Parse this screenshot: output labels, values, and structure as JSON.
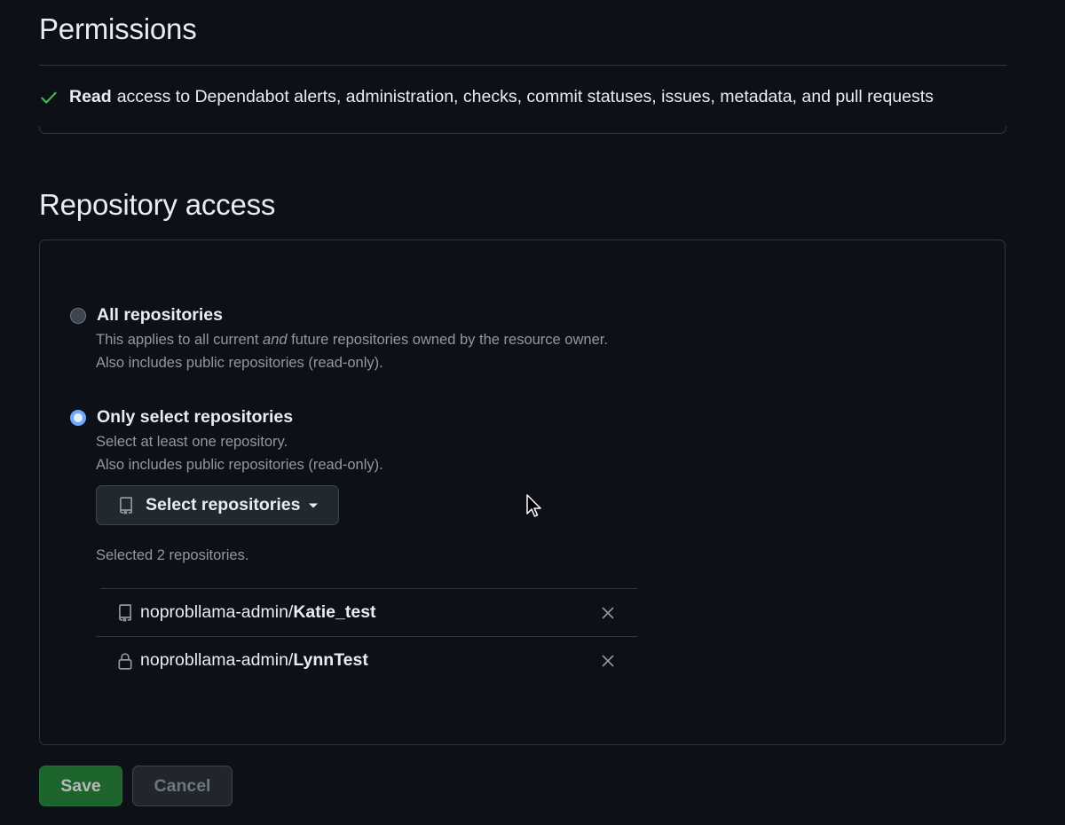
{
  "permissions": {
    "title": "Permissions",
    "row": {
      "strong": "Read",
      "text": "access to Dependabot alerts, administration, checks, commit statuses, issues, metadata, and pull requests",
      "icon": "check-icon"
    }
  },
  "repository_access": {
    "title": "Repository access",
    "options": [
      {
        "label": "All repositories",
        "selected": false,
        "desc_line1_pre": "This applies to all current",
        "desc_line1_em": "and",
        "desc_line1_post": "future repositories owned by the resource owner.",
        "desc_line2": "Also includes public repositories (read-only)."
      },
      {
        "label": "Only select repositories",
        "selected": true,
        "desc_line1": "Select at least one repository.",
        "desc_line2": "Also includes public repositories (read-only)."
      }
    ],
    "select_button_label": "Select repositories",
    "selected_count_text": "Selected 2 repositories.",
    "repos": [
      {
        "owner": "noprobllama-admin/",
        "name": "Katie_test",
        "icon": "repo-icon"
      },
      {
        "owner": "noprobllama-admin/",
        "name": "LynnTest",
        "icon": "lock-icon"
      }
    ]
  },
  "actions": {
    "save_label": "Save",
    "cancel_label": "Cancel"
  },
  "colors": {
    "background": "#0d1117",
    "border": "#30363d",
    "accent_radio": "#6ea8fe",
    "save_green": "#238636",
    "check_green": "#3fb950"
  }
}
